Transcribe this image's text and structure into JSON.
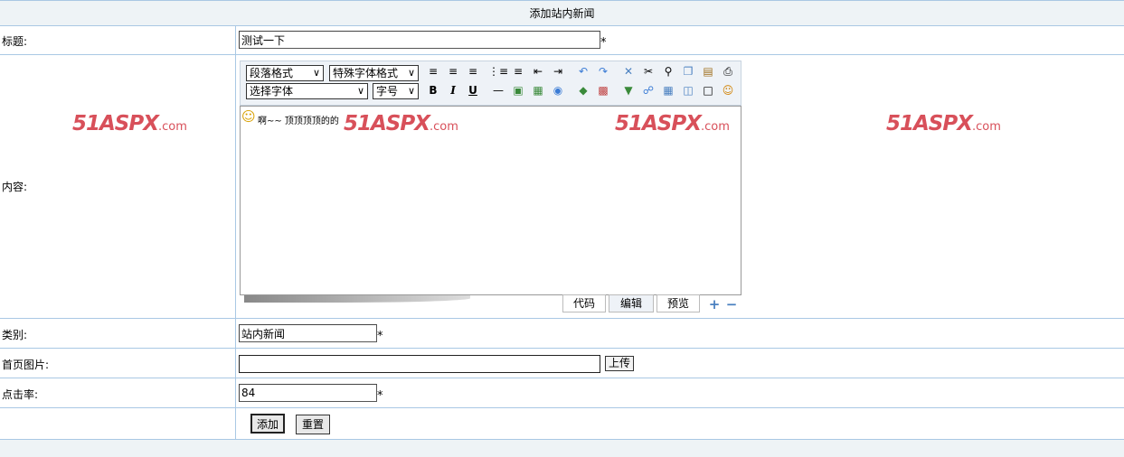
{
  "header": {
    "title": "添加站内新闻"
  },
  "form": {
    "title_label": "标题:",
    "title_value": "测试一下",
    "content_label": "内容:",
    "category_label": "类别:",
    "category_value": "站内新闻",
    "image_label": "首页图片:",
    "image_value": "",
    "upload_label": "上传",
    "clicks_label": "点击率:",
    "clicks_value": "84",
    "required_mark": "*",
    "add_label": "添加",
    "reset_label": "重置"
  },
  "editor": {
    "paragraph_format": "段落格式",
    "special_format": "特殊字体格式",
    "font_select": "选择字体",
    "font_size": "字号",
    "content_text": "啊~~ 顶顶顶顶的的 ",
    "tabs": [
      "代码",
      "编辑",
      "预览"
    ]
  },
  "watermark": {
    "brand": "51ASPX",
    "suffix": ".com"
  },
  "colors": {
    "border": "#a9c8e4",
    "header_bg": "#eef3f6",
    "watermark": "#d8505a"
  }
}
